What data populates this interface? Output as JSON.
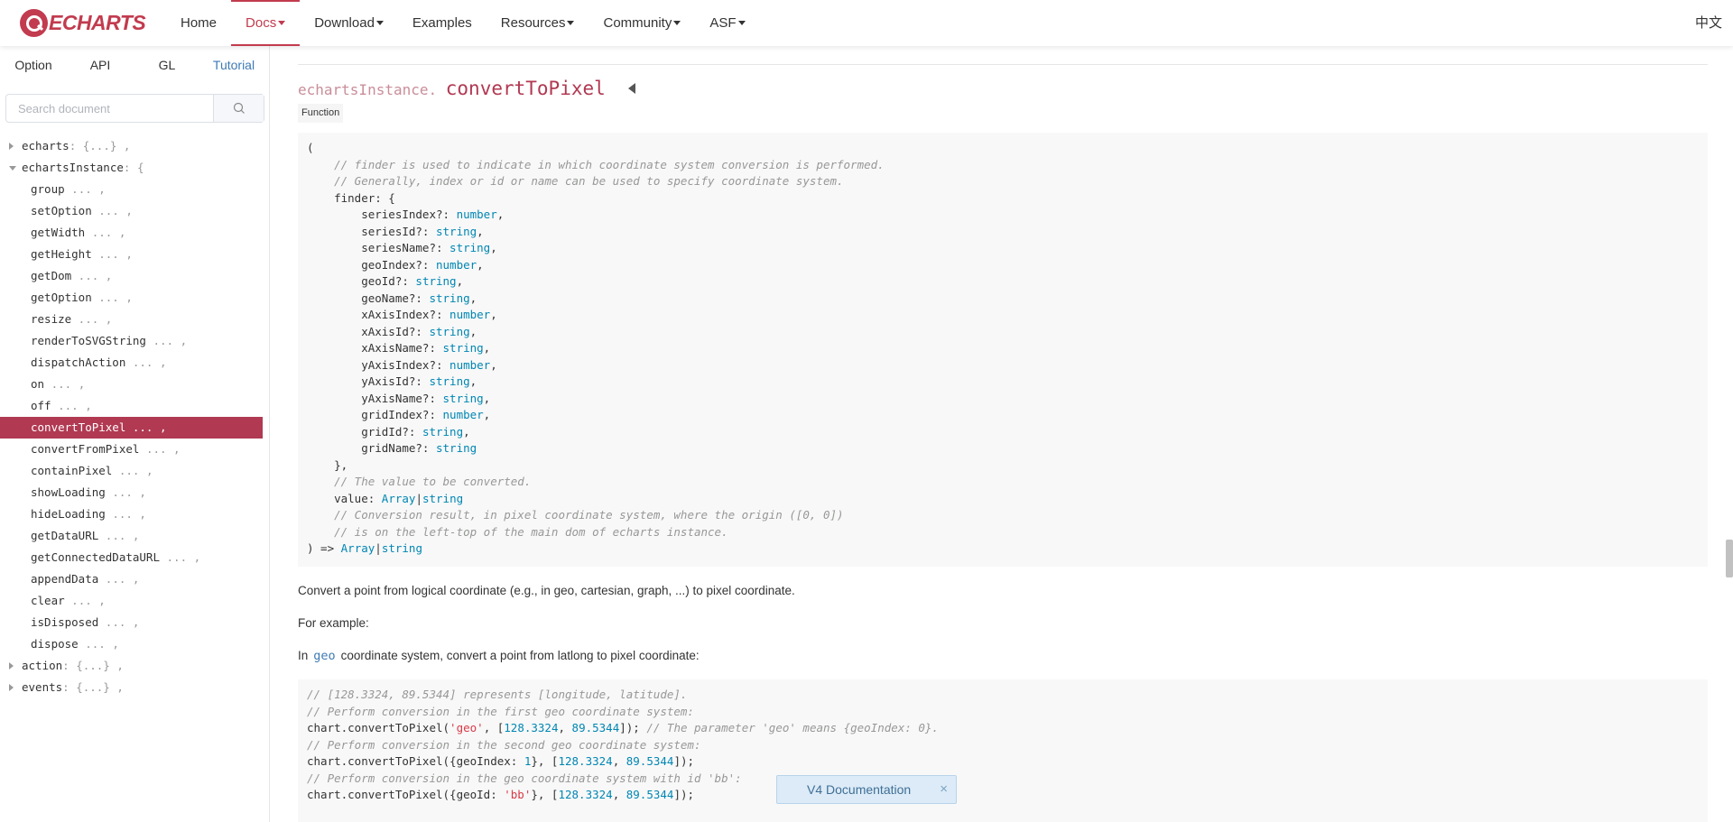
{
  "nav": {
    "logo_text": "ECHARTS",
    "items": [
      {
        "label": "Home",
        "dropdown": false,
        "active": false
      },
      {
        "label": "Docs",
        "dropdown": true,
        "active": true
      },
      {
        "label": "Download",
        "dropdown": true,
        "active": false
      },
      {
        "label": "Examples",
        "dropdown": false,
        "active": false
      },
      {
        "label": "Resources",
        "dropdown": true,
        "active": false
      },
      {
        "label": "Community",
        "dropdown": true,
        "active": false
      },
      {
        "label": "ASF",
        "dropdown": true,
        "active": false
      }
    ],
    "lang": "中文",
    "accent_color": "#c23b4e"
  },
  "sidebar": {
    "tabs": [
      {
        "label": "Option",
        "active": false
      },
      {
        "label": "API",
        "active": false
      },
      {
        "label": "GL",
        "active": false
      },
      {
        "label": "Tutorial",
        "active": true
      }
    ],
    "search_placeholder": "Search document",
    "tree": [
      {
        "name": "echarts",
        "suffix": ": {...} ,",
        "level": 0,
        "toggle": "right"
      },
      {
        "name": "echartsInstance",
        "suffix": ": {",
        "level": 0,
        "toggle": "down"
      },
      {
        "name": "group",
        "suffix": " ... ,",
        "level": 1
      },
      {
        "name": "setOption",
        "suffix": " ... ,",
        "level": 1
      },
      {
        "name": "getWidth",
        "suffix": " ... ,",
        "level": 1
      },
      {
        "name": "getHeight",
        "suffix": " ... ,",
        "level": 1
      },
      {
        "name": "getDom",
        "suffix": " ... ,",
        "level": 1
      },
      {
        "name": "getOption",
        "suffix": " ... ,",
        "level": 1
      },
      {
        "name": "resize",
        "suffix": " ... ,",
        "level": 1
      },
      {
        "name": "renderToSVGString",
        "suffix": " ... ,",
        "level": 1
      },
      {
        "name": "dispatchAction",
        "suffix": " ... ,",
        "level": 1
      },
      {
        "name": "on",
        "suffix": " ... ,",
        "level": 1
      },
      {
        "name": "off",
        "suffix": " ... ,",
        "level": 1
      },
      {
        "name": "convertToPixel",
        "suffix": " ... ,",
        "level": 1,
        "selected": true
      },
      {
        "name": "convertFromPixel",
        "suffix": " ... ,",
        "level": 1
      },
      {
        "name": "containPixel",
        "suffix": " ... ,",
        "level": 1
      },
      {
        "name": "showLoading",
        "suffix": " ... ,",
        "level": 1
      },
      {
        "name": "hideLoading",
        "suffix": " ... ,",
        "level": 1
      },
      {
        "name": "getDataURL",
        "suffix": " ... ,",
        "level": 1
      },
      {
        "name": "getConnectedDataURL",
        "suffix": " ... ,",
        "level": 1
      },
      {
        "name": "appendData",
        "suffix": " ... ,",
        "level": 1
      },
      {
        "name": "clear",
        "suffix": " ... ,",
        "level": 1
      },
      {
        "name": "isDisposed",
        "suffix": " ... ,",
        "level": 1
      },
      {
        "name": "dispose",
        "suffix": " ... ,",
        "level": 1
      },
      {
        "name": "action",
        "suffix": ": {...} ,",
        "level": 0,
        "toggle": "right"
      },
      {
        "name": "events",
        "suffix": ": {...} ,",
        "level": 0,
        "toggle": "right"
      }
    ]
  },
  "doc": {
    "prefix": "echartsInstance.",
    "name": "convertToPixel",
    "badge": "Function",
    "signature": [
      [
        [
          "p",
          "("
        ]
      ],
      [
        [
          "p",
          "    "
        ],
        [
          "c",
          "// finder is used to indicate in which coordinate system conversion is performed."
        ]
      ],
      [
        [
          "p",
          "    "
        ],
        [
          "c",
          "// Generally, index or id or name can be used to specify coordinate system."
        ]
      ],
      [
        [
          "p",
          "    finder: {"
        ]
      ],
      [
        [
          "p",
          "        seriesIndex?: "
        ],
        [
          "t",
          "number"
        ],
        [
          "p",
          ","
        ]
      ],
      [
        [
          "p",
          "        seriesId?: "
        ],
        [
          "t",
          "string"
        ],
        [
          "p",
          ","
        ]
      ],
      [
        [
          "p",
          "        seriesName?: "
        ],
        [
          "t",
          "string"
        ],
        [
          "p",
          ","
        ]
      ],
      [
        [
          "p",
          "        geoIndex?: "
        ],
        [
          "t",
          "number"
        ],
        [
          "p",
          ","
        ]
      ],
      [
        [
          "p",
          "        geoId?: "
        ],
        [
          "t",
          "string"
        ],
        [
          "p",
          ","
        ]
      ],
      [
        [
          "p",
          "        geoName?: "
        ],
        [
          "t",
          "string"
        ],
        [
          "p",
          ","
        ]
      ],
      [
        [
          "p",
          "        xAxisIndex?: "
        ],
        [
          "t",
          "number"
        ],
        [
          "p",
          ","
        ]
      ],
      [
        [
          "p",
          "        xAxisId?: "
        ],
        [
          "t",
          "string"
        ],
        [
          "p",
          ","
        ]
      ],
      [
        [
          "p",
          "        xAxisName?: "
        ],
        [
          "t",
          "string"
        ],
        [
          "p",
          ","
        ]
      ],
      [
        [
          "p",
          "        yAxisIndex?: "
        ],
        [
          "t",
          "number"
        ],
        [
          "p",
          ","
        ]
      ],
      [
        [
          "p",
          "        yAxisId?: "
        ],
        [
          "t",
          "string"
        ],
        [
          "p",
          ","
        ]
      ],
      [
        [
          "p",
          "        yAxisName?: "
        ],
        [
          "t",
          "string"
        ],
        [
          "p",
          ","
        ]
      ],
      [
        [
          "p",
          "        gridIndex?: "
        ],
        [
          "t",
          "number"
        ],
        [
          "p",
          ","
        ]
      ],
      [
        [
          "p",
          "        gridId?: "
        ],
        [
          "t",
          "string"
        ],
        [
          "p",
          ","
        ]
      ],
      [
        [
          "p",
          "        gridName?: "
        ],
        [
          "t",
          "string"
        ]
      ],
      [
        [
          "p",
          "    },"
        ]
      ],
      [
        [
          "p",
          "    "
        ],
        [
          "c",
          "// The value to be converted."
        ]
      ],
      [
        [
          "p",
          "    value: "
        ],
        [
          "t",
          "Array"
        ],
        [
          "p",
          "|"
        ],
        [
          "t",
          "string"
        ]
      ],
      [
        [
          "p",
          "    "
        ],
        [
          "c",
          "// Conversion result, in pixel coordinate system, where the origin ([0, 0])"
        ]
      ],
      [
        [
          "p",
          "    "
        ],
        [
          "c",
          "// is on the left-top of the main dom of echarts instance."
        ]
      ],
      [
        [
          "p",
          ") => "
        ],
        [
          "t",
          "Array"
        ],
        [
          "p",
          "|"
        ],
        [
          "t",
          "string"
        ]
      ]
    ],
    "desc1": "Convert a point from logical coordinate (e.g., in geo, cartesian, graph, ...) to pixel coordinate.",
    "desc2": "For example:",
    "desc3_before": "In",
    "desc3_kw": "geo",
    "desc3_after": "coordinate system, convert a point from latlong to pixel coordinate:",
    "example": [
      [
        [
          "c",
          "// [128.3324, 89.5344] represents [longitude, latitude]."
        ]
      ],
      [
        [
          "c",
          "// Perform conversion in the first geo coordinate system:"
        ]
      ],
      [
        [
          "p",
          "chart.convertToPixel("
        ],
        [
          "r",
          "'geo'"
        ],
        [
          "p",
          ", ["
        ],
        [
          "n",
          "128.3324"
        ],
        [
          "p",
          ", "
        ],
        [
          "n",
          "89.5344"
        ],
        [
          "p",
          "]); "
        ],
        [
          "c",
          "// The parameter 'geo' means {geoIndex: 0}."
        ]
      ],
      [
        [
          "c",
          "// Perform conversion in the second geo coordinate system:"
        ]
      ],
      [
        [
          "p",
          "chart.convertToPixel({geoIndex: "
        ],
        [
          "n",
          "1"
        ],
        [
          "p",
          "}, ["
        ],
        [
          "n",
          "128.3324"
        ],
        [
          "p",
          ", "
        ],
        [
          "n",
          "89.5344"
        ],
        [
          "p",
          "]);"
        ]
      ],
      [
        [
          "c",
          "// Perform conversion in the geo coordinate system with id 'bb':"
        ]
      ],
      [
        [
          "p",
          "chart.convertToPixel({geoId: "
        ],
        [
          "r",
          "'bb'"
        ],
        [
          "p",
          "}, ["
        ],
        [
          "n",
          "128.3324"
        ],
        [
          "p",
          ", "
        ],
        [
          "n",
          "89.5344"
        ],
        [
          "p",
          "]);"
        ]
      ]
    ]
  },
  "toast": {
    "label": "V4 Documentation",
    "close": "×"
  }
}
